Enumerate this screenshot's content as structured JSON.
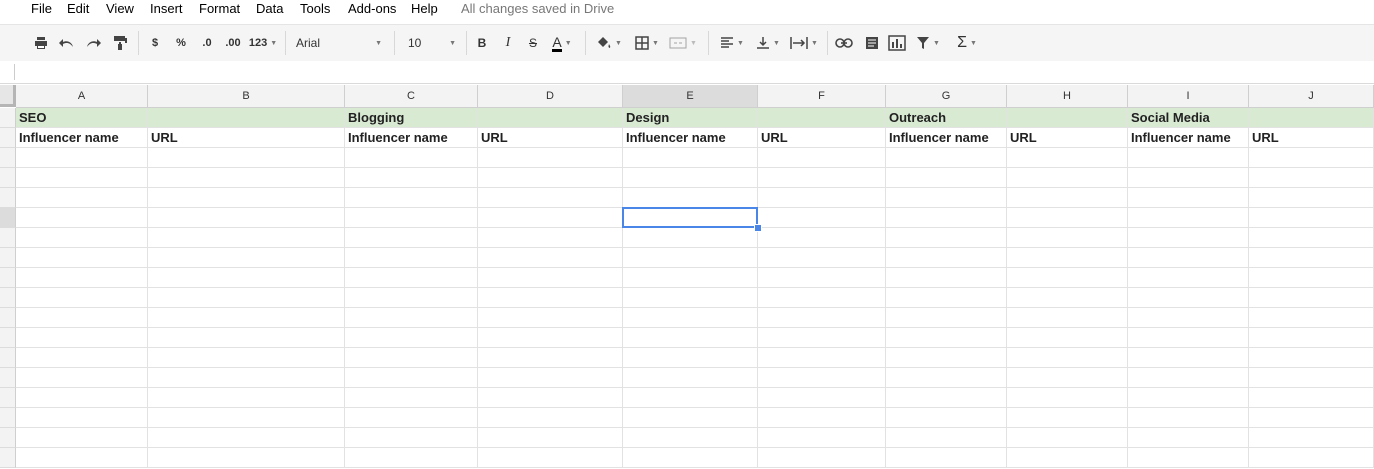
{
  "menu": {
    "items": [
      "File",
      "Edit",
      "View",
      "Insert",
      "Format",
      "Data",
      "Tools",
      "Add-ons",
      "Help"
    ],
    "save_status": "All changes saved in Drive"
  },
  "toolbar": {
    "currency_label": "$",
    "percent_label": "%",
    "decrease_decimal_label": ".0",
    "increase_decimal_label": ".00",
    "more_formats_label": "123",
    "font_family": "Arial",
    "font_size": "10",
    "bold_label": "B",
    "italic_label": "I",
    "strikethrough_label": "S",
    "text_color_label": "A",
    "icons": [
      "print-icon",
      "undo-icon",
      "redo-icon",
      "paint-format-icon",
      "fill-color-icon",
      "borders-icon",
      "merge-cells-icon",
      "horizontal-align-icon",
      "vertical-align-icon",
      "text-wrap-icon",
      "link-icon",
      "comment-icon",
      "chart-icon",
      "filter-icon",
      "functions-icon"
    ],
    "functions_label": "Σ"
  },
  "grid": {
    "columns": [
      "A",
      "B",
      "C",
      "D",
      "E",
      "F",
      "G",
      "H",
      "I",
      "J"
    ],
    "selected_column": "E",
    "selected_cell": "E6",
    "header_color": "#d9ead3",
    "selection_color": "#4a86e8",
    "rows": [
      [
        "SEO",
        "",
        "Blogging",
        "",
        "Design",
        "",
        "Outreach",
        "",
        "Social Media",
        ""
      ],
      [
        "Influencer name",
        "URL",
        "Influencer name",
        "URL",
        "Influencer name",
        "URL",
        "Influencer name",
        "URL",
        "Influencer name",
        "URL"
      ]
    ]
  }
}
